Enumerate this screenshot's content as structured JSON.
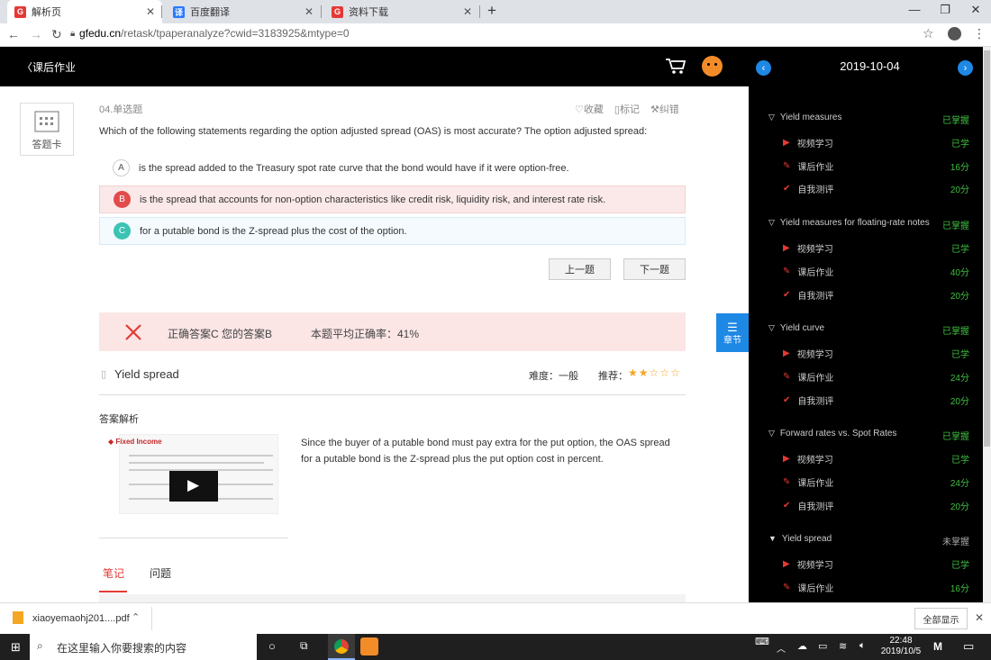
{
  "browser": {
    "tabs": [
      {
        "title": "解析页",
        "icon": "gfedu-icon",
        "active": true
      },
      {
        "title": "百度翻译",
        "icon": "translate-icon",
        "active": false
      },
      {
        "title": "资料下载",
        "icon": "gfedu-icon",
        "active": false
      }
    ],
    "new_tab": "+",
    "url_host": "gfedu.cn",
    "url_path": "/retask/tpaperanalyze?cwid=3183925&mtype=0"
  },
  "header": {
    "back_label": "课后作业"
  },
  "answer_card": {
    "label": "答题卡"
  },
  "question": {
    "number_type": "04.单选题",
    "actions": {
      "favorite": "收藏",
      "mark": "标记",
      "report": "纠错"
    },
    "text": "Which of the following statements regarding the option adjusted spread (OAS) is most accurate? The option adjusted spread:",
    "options": [
      {
        "letter": "A",
        "text": "is the spread added to the Treasury spot rate curve that the bond would have if it were option-free."
      },
      {
        "letter": "B",
        "text": "is the spread that accounts for non-option characteristics like credit risk, liquidity risk, and interest rate risk."
      },
      {
        "letter": "C",
        "text": "for a putable bond is the Z-spread plus the cost of the option."
      }
    ],
    "prev_label": "上一题",
    "next_label": "下一题"
  },
  "result": {
    "answer_text": "正确答案C 您的答案B",
    "accuracy_text": "本题平均正确率：41%"
  },
  "topic": {
    "name": "Yield spread",
    "difficulty": "难度：一般",
    "recommend": "推荐：",
    "stars_filled": 2,
    "stars_total": 5
  },
  "analysis": {
    "heading": "答案解析",
    "video_brand": "Fixed Income",
    "text": "Since the buyer of a putable bond must pay extra for the put option, the OAS spread for a putable bond is the Z-spread plus the put option cost in percent."
  },
  "bottom_tabs": {
    "notes": "笔记",
    "questions": "问题"
  },
  "chapter_btn": "章节",
  "sidebar": {
    "date": "2019-10-04",
    "sections": [
      {
        "title": "Yield measures",
        "status": "已掌握",
        "items": [
          {
            "label": "视频学习",
            "value": "已学"
          },
          {
            "label": "课后作业",
            "value": "16分"
          },
          {
            "label": "自我测评",
            "value": "20分"
          }
        ]
      },
      {
        "title": "Yield measures for floating-rate notes",
        "status": "已掌握",
        "items": [
          {
            "label": "视频学习",
            "value": "已学"
          },
          {
            "label": "课后作业",
            "value": "40分"
          },
          {
            "label": "自我测评",
            "value": "20分"
          }
        ]
      },
      {
        "title": "Yield curve",
        "status": "已掌握",
        "items": [
          {
            "label": "视频学习",
            "value": "已学"
          },
          {
            "label": "课后作业",
            "value": "24分"
          },
          {
            "label": "自我测评",
            "value": "20分"
          }
        ]
      },
      {
        "title": "Forward rates vs. Spot Rates",
        "status": "已掌握",
        "items": [
          {
            "label": "视频学习",
            "value": "已学"
          },
          {
            "label": "课后作业",
            "value": "24分"
          },
          {
            "label": "自我测评",
            "value": "20分"
          }
        ]
      },
      {
        "title": "Yield spread",
        "status": "未掌握",
        "items": [
          {
            "label": "视频学习",
            "value": "已学"
          },
          {
            "label": "课后作业",
            "value": "16分"
          }
        ]
      }
    ]
  },
  "download": {
    "filename": "xiaoyemaohj201....pdf",
    "show_all": "全部显示"
  },
  "taskbar": {
    "search_placeholder": "在这里输入你要搜索的内容",
    "time": "22:48",
    "date": "2019/10/5"
  }
}
